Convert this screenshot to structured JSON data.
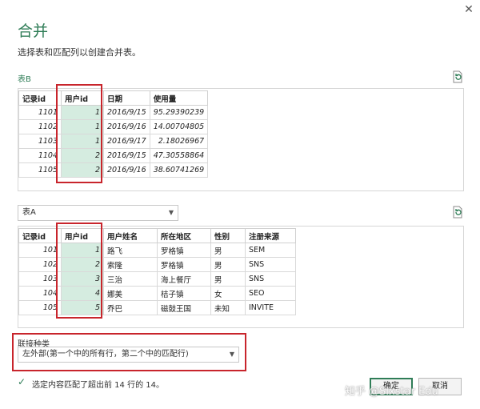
{
  "dialog": {
    "close_icon": "✕",
    "title": "合并",
    "subtitle": "选择表和匹配列以创建合并表。"
  },
  "table_b": {
    "label": "表B",
    "columns": [
      "记录id",
      "用户id",
      "日期",
      "使用量"
    ],
    "rows": [
      [
        "1101",
        "1",
        "2016/9/15",
        "95.29390239"
      ],
      [
        "1102",
        "1",
        "2016/9/16",
        "14.00704805"
      ],
      [
        "1103",
        "1",
        "2016/9/17",
        "2.18026967"
      ],
      [
        "1104",
        "2",
        "2016/9/15",
        "47.30558864"
      ],
      [
        "1105",
        "2",
        "2016/9/16",
        "38.60741269"
      ]
    ]
  },
  "table_a": {
    "selected": "表A",
    "columns": [
      "记录id",
      "用户id",
      "用户姓名",
      "所在地区",
      "性别",
      "注册来源"
    ],
    "rows": [
      [
        "101",
        "1",
        "路飞",
        "罗格镇",
        "男",
        "SEM"
      ],
      [
        "102",
        "2",
        "索隆",
        "罗格镇",
        "男",
        "SNS"
      ],
      [
        "103",
        "3",
        "三治",
        "海上餐厅",
        "男",
        "SNS"
      ],
      [
        "104",
        "4",
        "娜美",
        "桔子镇",
        "女",
        "SEO"
      ],
      [
        "105",
        "5",
        "乔巴",
        "磁鼓王国",
        "未知",
        "INVITE"
      ]
    ]
  },
  "join": {
    "label": "联接种类",
    "selected": "左外部(第一个中的所有行，第二个中的匹配行)"
  },
  "status": {
    "check_icon": "✓",
    "text": "选定内容匹配了超出前 14 行的 14。"
  },
  "buttons": {
    "ok": "确定",
    "cancel": "取消"
  },
  "watermark": "知乎 @Sixstar Edu",
  "colors": {
    "accent": "#2f7d57",
    "selected_column": "#d5ece0",
    "highlight_box": "#c8252c"
  }
}
